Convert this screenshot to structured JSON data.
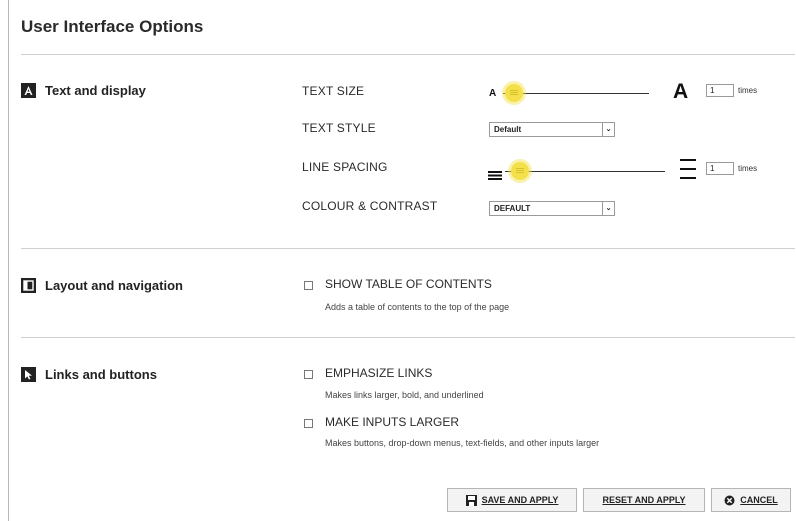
{
  "title": "User Interface Options",
  "sections": {
    "text_display": {
      "label": "Text and display",
      "text_size": {
        "label": "TEXT SIZE",
        "small": "A",
        "large": "A",
        "value": "1",
        "unit": "times"
      },
      "text_style": {
        "label": "TEXT STYLE",
        "selected": "Default",
        "arrow": "⌄"
      },
      "line_spacing": {
        "label": "LINE SPACING",
        "value": "1",
        "unit": "times"
      },
      "colour_contrast": {
        "label": "COLOUR & CONTRAST",
        "selected": "DEFAULT",
        "arrow": "⌄"
      }
    },
    "layout_nav": {
      "label": "Layout and navigation",
      "toc": {
        "label": "SHOW TABLE OF CONTENTS",
        "desc": "Adds a table of contents to the top of the page"
      }
    },
    "links_buttons": {
      "label": "Links and buttons",
      "emphasize": {
        "label": "EMPHASIZE LINKS",
        "desc": "Makes links larger, bold, and underlined"
      },
      "inputs": {
        "label": "MAKE INPUTS LARGER",
        "desc": "Makes buttons, drop-down menus, text-fields, and other inputs larger"
      }
    }
  },
  "buttons": {
    "save": "SAVE AND APPLY",
    "reset": "RESET AND APPLY",
    "cancel": "CANCEL"
  },
  "colors": {
    "slider_knob": "#f4e04a",
    "icon": "#222222"
  }
}
